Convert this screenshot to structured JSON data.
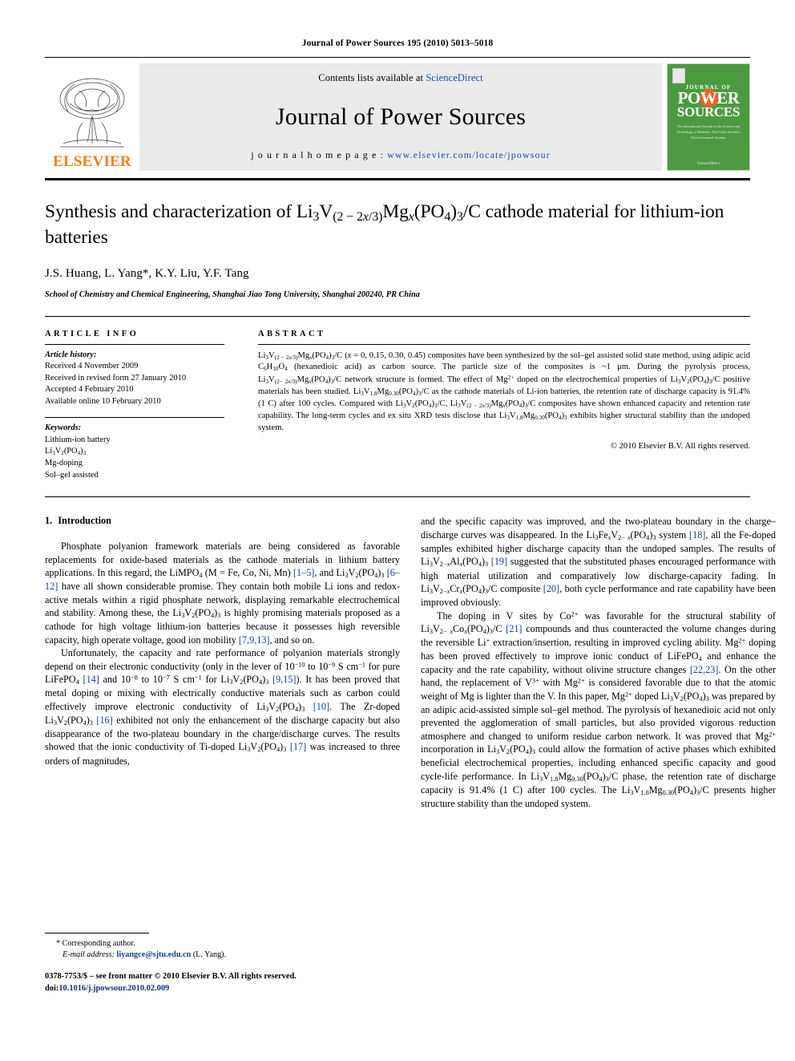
{
  "running_head": "Journal of Power Sources 195 (2010) 5013–5018",
  "masthead": {
    "contents_prefix": "Contents lists available at ",
    "sciencedirect": "ScienceDirect",
    "journal_name": "Journal of Power Sources",
    "homepage_prefix": "j o u r n a l   h o m e p a g e :  ",
    "homepage_url": "www.elsevier.com/locate/jpowsour",
    "publisher": "ELSEVIER",
    "cover": {
      "kicker": "JOURNAL OF",
      "title_line1": "POWER",
      "title_line2": "SOURCES",
      "subtitle": "The International Journal on the Science and Technology of Batteries, Fuel Cells and other Electrochemical Systems",
      "footer": "ScienceDirect",
      "accent_green": "#4c9a3f",
      "accent_orange": "#e8642a"
    }
  },
  "article": {
    "title_part1": "Synthesis and characterization of Li",
    "title": "Synthesis and characterization of Li3V(2−2x/3)Mgx(PO4)3/C cathode material for lithium-ion batteries",
    "authors": "J.S. Huang, L. Yang*, K.Y. Liu, Y.F. Tang",
    "affiliation": "School of Chemistry and Chemical Engineering, Shanghai Jiao Tong University, Shanghai 200240, PR China"
  },
  "article_info": {
    "heading": "ARTICLE INFO",
    "history_label": "Article history:",
    "history": [
      "Received 4 November 2009",
      "Received in revised form 27 January 2010",
      "Accepted 4 February 2010",
      "Available online 10 February 2010"
    ],
    "keywords_label": "Keywords:",
    "keywords": [
      "Lithium-ion battery",
      "Li3V2(PO4)3",
      "Mg-doping",
      "Sol–gel assisted"
    ]
  },
  "abstract": {
    "heading": "ABSTRACT",
    "copyright": "© 2010 Elsevier B.V. All rights reserved."
  },
  "introduction": {
    "number": "1.",
    "title": "Introduction"
  },
  "footnote": {
    "corresponding": "* Corresponding author.",
    "email_label": "E-mail address:",
    "email": "liyangce@sjtu.edu.cn",
    "email_suffix": "(L. Yang)."
  },
  "footer": {
    "issn_line": "0378-7753/$ – see front matter © 2010 Elsevier B.V. All rights reserved.",
    "doi_label": "doi:",
    "doi": "10.1016/j.jpowsour.2010.02.009"
  }
}
